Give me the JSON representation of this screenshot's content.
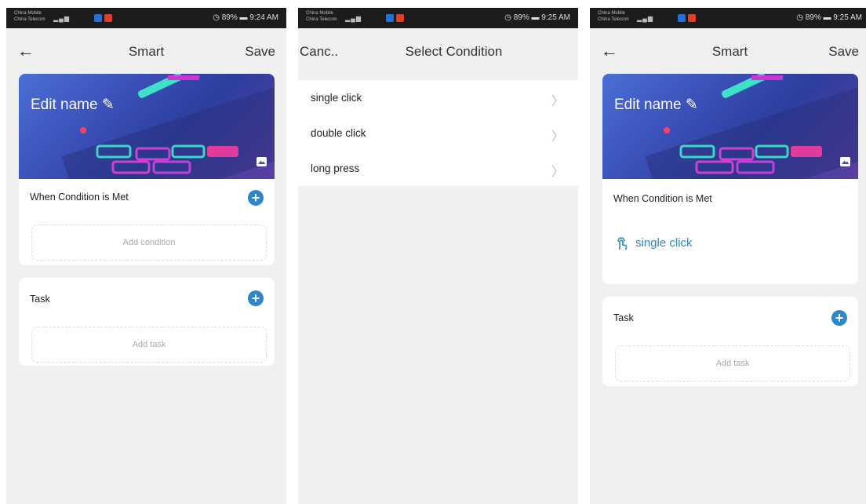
{
  "status": {
    "carrier1": "China Mobile",
    "carrier2": "China Telecom",
    "battery": "89%",
    "times": [
      "9:24 AM",
      "9:25 AM",
      "9:25 AM"
    ]
  },
  "screen1": {
    "title": "Smart",
    "save": "Save",
    "edit_name": "Edit name",
    "condition_title": "When Condition is Met",
    "add_condition": "Add condition",
    "task_title": "Task",
    "add_task": "Add task"
  },
  "screen2": {
    "cancel": "Canc..",
    "title": "Select Condition",
    "items": [
      "single click",
      "double click",
      "long press"
    ]
  },
  "screen3": {
    "title": "Smart",
    "save": "Save",
    "edit_name": "Edit name",
    "condition_title": "When Condition is Met",
    "condition_value": "single click",
    "task_title": "Task",
    "add_task": "Add task"
  },
  "colors": {
    "accent": "#2f86c8",
    "background": "#f0f0f0"
  }
}
